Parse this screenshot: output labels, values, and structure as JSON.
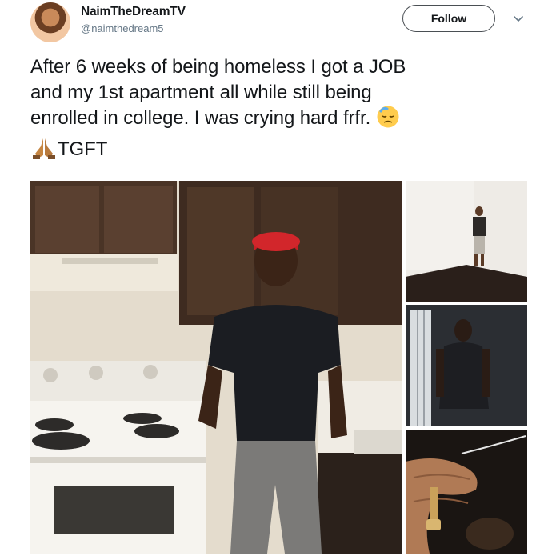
{
  "tweet": {
    "author": {
      "display_name": "NaimTheDreamTV",
      "handle": "@naimthedream5"
    },
    "follow_label": "Follow",
    "text_lines": [
      "After 6 weeks of being homeless I got a JOB",
      "and my 1st apartment all while still being",
      "enrolled in college. I was crying hard frfr.",
      "TGFT"
    ],
    "emojis": {
      "line3_end": "sad-relieved-face-emoji",
      "line4_start": "folded-hands-emoji"
    },
    "media": [
      {
        "name": "man-in-kitchen-photo"
      },
      {
        "name": "man-in-empty-room-photo"
      },
      {
        "name": "silhouette-by-window-photo"
      },
      {
        "name": "hand-holding-key-photo"
      }
    ]
  },
  "colors": {
    "text": "#14171a",
    "secondary_text": "#657786",
    "button_border": "#4a4f54"
  }
}
